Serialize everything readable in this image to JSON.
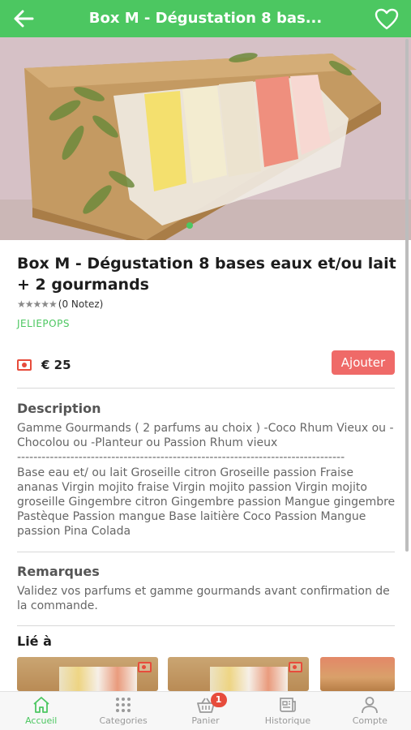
{
  "header": {
    "title": "Box M - Dégustation 8 bas..."
  },
  "product": {
    "title": "Box M - Dégustation 8 bases eaux et/ou lait + 2 gourmands",
    "rating_text": "(0 Notez)",
    "stars": "★★★★★",
    "brand": "JELIEPOPS",
    "price": "€ 25",
    "add_label": "Ajouter",
    "image_index": 1,
    "image_count": 1
  },
  "description": {
    "title": "Description",
    "text1": "Gamme Gourmands ( 2 parfums au choix ) -Coco Rhum Vieux ou -Chocolou ou -Planteur ou Passion Rhum vieux",
    "dashes": "--------------------------------------------------------------------------------",
    "text2": "Base eau et/ ou lait Groseille citron Groseille passion Fraise ananas Virgin mojito fraise Virgin mojito passion Virgin mojito groseille Gingembre citron Gingembre passion Mangue gingembre Pastèque Passion mangue Base laitière Coco Passion Mangue passion Pina Colada"
  },
  "remarks": {
    "title": "Remarques",
    "text": "Validez vos parfums et gamme gourmands avant confirmation de la commande."
  },
  "related": {
    "title": "Lié à"
  },
  "nav": {
    "home": "Accueil",
    "categories": "Categories",
    "cart": "Panier",
    "cart_count": "1",
    "history": "Historique",
    "account": "Compte"
  },
  "colors": {
    "primary_green": "#4cc761",
    "accent_red": "#ef6a68",
    "badge_red": "#e74c3c"
  },
  "icons": {
    "back": "arrow-left-icon",
    "favorite": "heart-outline-icon",
    "price": "price-tag-icon",
    "home": "home-icon",
    "categories": "grid-icon",
    "cart": "basket-icon",
    "history": "newspaper-icon",
    "account": "user-icon"
  }
}
